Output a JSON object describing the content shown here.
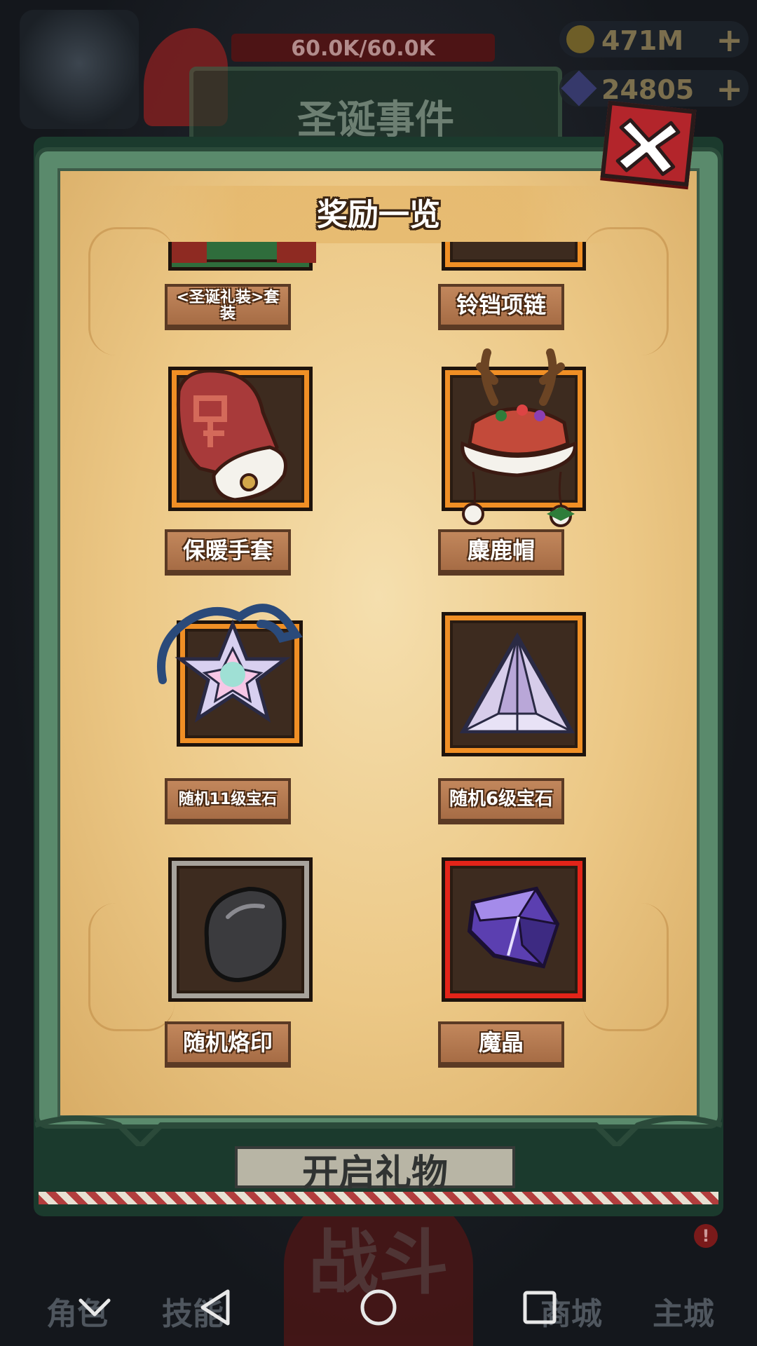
{
  "status": {
    "hp_text": "60.0K/60.0K",
    "event_title": "圣诞事件",
    "gold": "471M",
    "gems": "24805",
    "plus": "+"
  },
  "dialog": {
    "title": "奖励一览",
    "close_icon": "close-x-icon",
    "rewards": [
      {
        "label": "<圣诞礼装>套装",
        "icon": "christmas-outfit-icon",
        "frame": "green"
      },
      {
        "label": "铃铛项链",
        "icon": "bell-necklace-icon",
        "frame": "orange"
      },
      {
        "label": "保暖手套",
        "icon": "warm-mitten-icon",
        "frame": "orange"
      },
      {
        "label": "麋鹿帽",
        "icon": "reindeer-hat-icon",
        "frame": "orange"
      },
      {
        "label": "随机11级宝石",
        "icon": "level11-gem-icon",
        "frame": "orange"
      },
      {
        "label": "随机6级宝石",
        "icon": "level6-gem-icon",
        "frame": "orange"
      },
      {
        "label": "随机烙印",
        "icon": "brand-stone-icon",
        "frame": "gray"
      },
      {
        "label": "魔晶",
        "icon": "magic-crystal-icon",
        "frame": "red"
      }
    ],
    "behind_button": "开启礼物"
  },
  "bottom_nav": {
    "bag": "角色",
    "skill": "技能",
    "battle": "战斗",
    "shop": "商城",
    "main": "主城",
    "alert": "!"
  },
  "system_nav": {
    "hide": "chevron-down-icon",
    "back": "back-triangle-icon",
    "home": "home-circle-icon",
    "recent": "recent-square-icon"
  }
}
